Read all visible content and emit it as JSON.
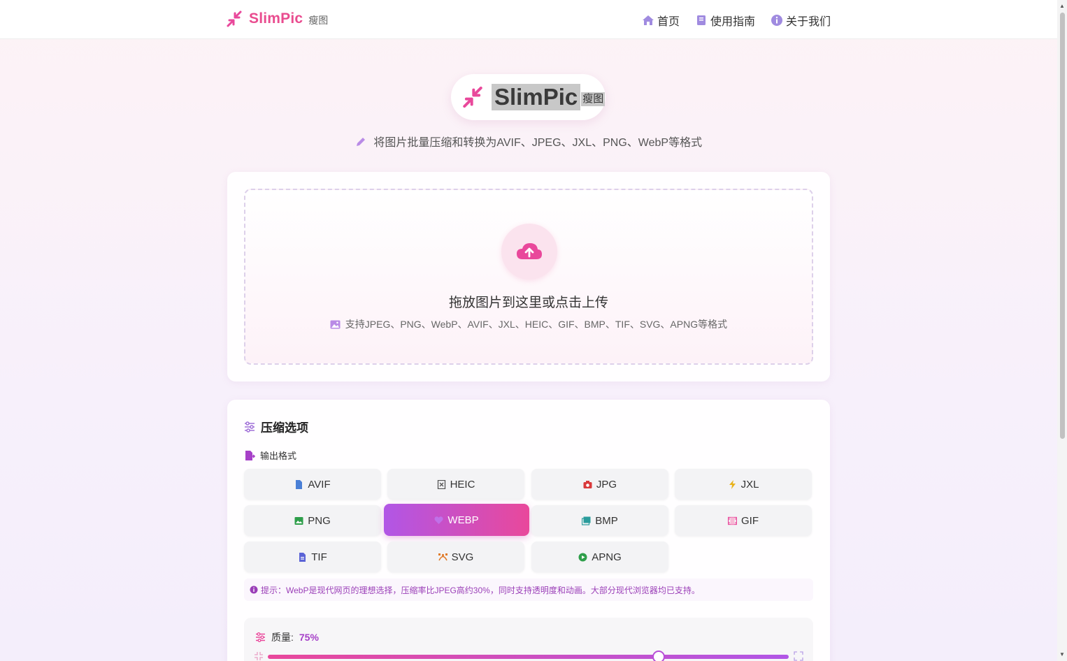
{
  "nav": {
    "brand_name": "SlimPic",
    "brand_sub": "瘦图",
    "links": [
      {
        "label": "首页",
        "icon": "home-icon"
      },
      {
        "label": "使用指南",
        "icon": "book-icon"
      },
      {
        "label": "关于我们",
        "icon": "info-icon"
      }
    ]
  },
  "hero": {
    "name": "SlimPic",
    "sub": "瘦图",
    "tagline": "将图片批量压缩和转换为AVIF、JPEG、JXL、PNG、WebP等格式"
  },
  "upload": {
    "title": "拖放图片到这里或点击上传",
    "hint": "支持JPEG、PNG、WebP、AVIF、JXL、HEIC、GIF、BMP、TIF、SVG、APNG等格式"
  },
  "options": {
    "title": "压缩选项",
    "format_label": "输出格式",
    "formats": [
      {
        "label": "AVIF",
        "icon": "file-icon",
        "color": "#4a7fd6"
      },
      {
        "label": "HEIC",
        "icon": "file-x-icon",
        "color": "#555555"
      },
      {
        "label": "JPG",
        "icon": "camera-icon",
        "color": "#d9393b"
      },
      {
        "label": "JXL",
        "icon": "bolt-icon",
        "color": "#e8b21a"
      },
      {
        "label": "PNG",
        "icon": "image-icon",
        "color": "#2e9e4a"
      },
      {
        "label": "WEBP",
        "icon": "heart-icon",
        "color": "#a640c8",
        "selected": true
      },
      {
        "label": "BMP",
        "icon": "images-icon",
        "color": "#2a9c9c"
      },
      {
        "label": "GIF",
        "icon": "film-icon",
        "color": "#e9489b"
      },
      {
        "label": "TIF",
        "icon": "file-icon",
        "color": "#5b63d6"
      },
      {
        "label": "SVG",
        "icon": "bezier-icon",
        "color": "#e07b2a"
      },
      {
        "label": "APNG",
        "icon": "play-icon",
        "color": "#2e9e4a"
      }
    ],
    "tip": "提示：WebP是现代网页的理想选择，压缩率比JPEG高约30%，同时支持透明度和动画。大部分现代浏览器均已支持。",
    "quality_label": "质量:",
    "quality_value": "75%",
    "quality": 0.75
  },
  "colors": {
    "accent_pink": "#e9489b",
    "accent_purple": "#b156e6"
  }
}
